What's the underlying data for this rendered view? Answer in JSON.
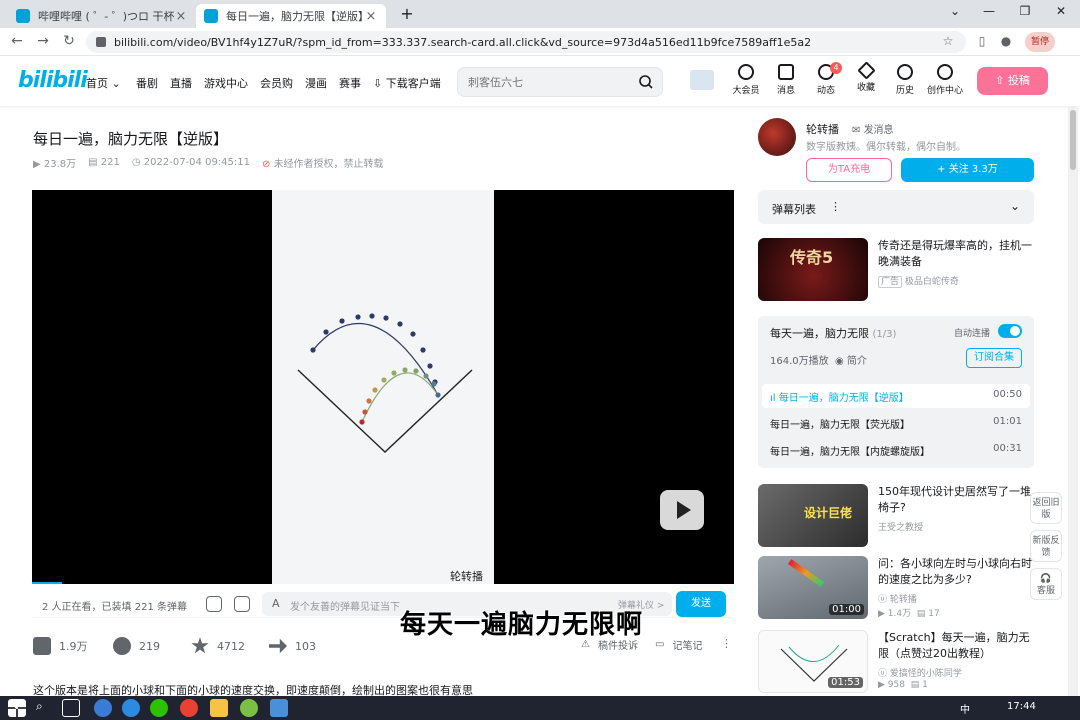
{
  "browser": {
    "tabs": [
      {
        "label": "哔哩哔哩 ( ゜- ゜)つロ 干杯~-bili",
        "active": false
      },
      {
        "label": "每日一遍，脑力无限【逆版】_哔",
        "active": true
      }
    ],
    "new_tab": "+",
    "url": "bilibili.com/video/BV1hf4y1Z7uR/?spm_id_from=333.337.search-card.all.click&vd_source=973d4a516ed11b9fce7589aff1e5a2",
    "profile_label": "暂停"
  },
  "header": {
    "logo": "bilibili",
    "nav": [
      "首页",
      "番剧",
      "直播",
      "游戏中心",
      "会员购",
      "漫画",
      "赛事",
      "下载客户端"
    ],
    "search_placeholder": "刺客伍六七",
    "icons": [
      {
        "label": "大会员",
        "icon": "vip-icon"
      },
      {
        "label": "消息",
        "icon": "message-icon"
      },
      {
        "label": "动态",
        "icon": "dynamic-icon",
        "badge": "4"
      },
      {
        "label": "收藏",
        "icon": "favorite-icon"
      },
      {
        "label": "历史",
        "icon": "history-icon"
      },
      {
        "label": "创作中心",
        "icon": "creator-icon"
      }
    ],
    "upload_label": "投稿"
  },
  "video": {
    "title": "每日一遍，脑力无限【逆版】",
    "views": "23.8万",
    "danmaku_count": "221",
    "date": "2022-07-04 09:45:11",
    "copyright": "未经作者授权，禁止转载",
    "watermark": "轮转播",
    "watching": "2 人正在看，已装填 221 条弹幕",
    "danmaku_placeholder": "发个友善的弹幕见证当下",
    "etiquette": "弹幕礼仪 >",
    "send_label": "发送",
    "subtitle": "每天一遍脑力无限啊",
    "likes": "1.9万",
    "coins": "219",
    "favorites": "4712",
    "shares": "103",
    "report": "稿件投诉",
    "notes": "记笔记",
    "description": "这个版本是将上面的小球和下面的小球的速度交换，即速度颠倒，绘制出的图案也很有意思"
  },
  "up": {
    "name": "轮转播",
    "message_label": "发消息",
    "signature": "数字版教姨。偶尔转载，偶尔自制。",
    "charge_label": "为TA充电",
    "follow_label": "+ 关注 3.3万"
  },
  "danmaku_list_label": "弹幕列表",
  "ad": {
    "title": "传奇还是得玩爆率高的，挂机一晚满装备",
    "tag": "广告",
    "source": "极品白蛇传奇",
    "thumb_text": "传奇5"
  },
  "playlist": {
    "title": "每天一遍，脑力无限",
    "count": "(1/3)",
    "autoplay_label": "自动连播",
    "stats": "164.0万播放",
    "intro": "简介",
    "subscribe_label": "订阅合集",
    "items": [
      {
        "label": "每日一遍，脑力无限【逆版】",
        "duration": "00:50",
        "current": true
      },
      {
        "label": "每日一遍，脑力无限【荧光版】",
        "duration": "01:01",
        "current": false
      },
      {
        "label": "每日一遍，脑力无限【内旋螺旋版】",
        "duration": "00:31",
        "current": false
      }
    ]
  },
  "recommendations": [
    {
      "title": "150年现代设计史居然写了一堆椅子?",
      "author": "王受之教授",
      "stats": "",
      "duration": "",
      "thumb_text": "设计巨佬"
    },
    {
      "title": "问：各小球向左时与小球向右时的速度之比为多少?",
      "author": "轮转播",
      "stats": "1.4万",
      "danmaku": "17",
      "duration": "01:00"
    },
    {
      "title": "【Scratch】每天一遍，脑力无限（点赞过20出教程）",
      "author": "爱搞怪的小陈同学",
      "stats": "958",
      "danmaku": "1",
      "duration": "01:53"
    }
  ],
  "float_buttons": [
    "返回旧版",
    "新版反馈",
    "客服"
  ],
  "taskbar": {
    "ime": "中",
    "clock": "17:44"
  },
  "colors": {
    "brand_blue": "#00aeec",
    "brand_pink": "#fb7299"
  }
}
